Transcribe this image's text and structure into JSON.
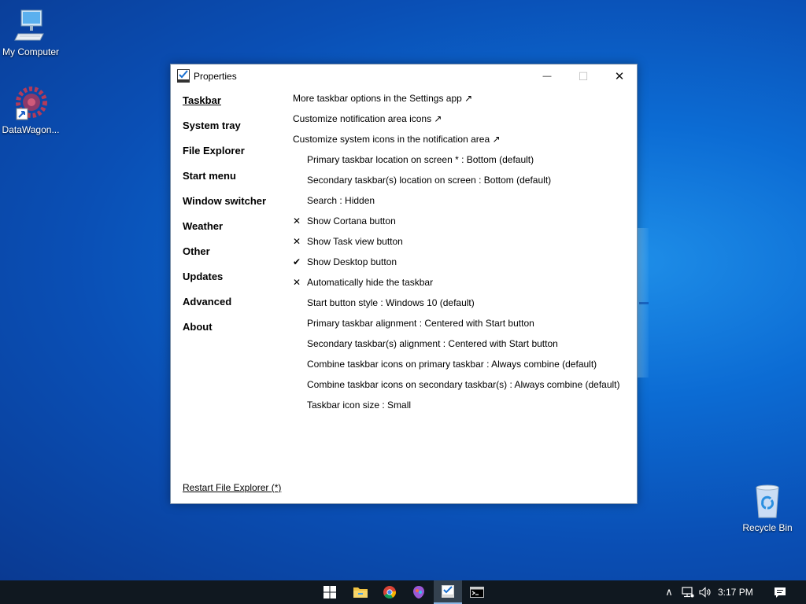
{
  "desktop": {
    "icons": [
      {
        "label": "My Computer"
      },
      {
        "label": "DataWagon..."
      },
      {
        "label": "Recycle Bin"
      }
    ]
  },
  "window": {
    "title": "Properties",
    "minimize_glyph": "—",
    "maximize_glyph": "☐",
    "close_glyph": "✕",
    "nav": [
      {
        "label": "Taskbar",
        "active": true
      },
      {
        "label": "System tray"
      },
      {
        "label": "File Explorer"
      },
      {
        "label": "Start menu"
      },
      {
        "label": "Window switcher"
      },
      {
        "label": "Weather"
      },
      {
        "label": "Other"
      },
      {
        "label": "Updates"
      },
      {
        "label": "Advanced"
      },
      {
        "label": "About"
      }
    ],
    "links": [
      {
        "label": "More taskbar options in the Settings app ↗"
      },
      {
        "label": "Customize notification area icons ↗"
      },
      {
        "label": "Customize system icons in the notification area ↗"
      }
    ],
    "settings": [
      {
        "mark": "",
        "label": "Primary taskbar location on screen * : Bottom (default)"
      },
      {
        "mark": "",
        "label": "Secondary taskbar(s) location on screen : Bottom (default)"
      },
      {
        "mark": "",
        "label": "Search : Hidden"
      },
      {
        "mark": "✕",
        "label": "Show Cortana button"
      },
      {
        "mark": "✕",
        "label": "Show Task view button"
      },
      {
        "mark": "✔",
        "label": "Show Desktop button"
      },
      {
        "mark": "✕",
        "label": "Automatically hide the taskbar"
      },
      {
        "mark": "",
        "label": "Start button style : Windows 10 (default)"
      },
      {
        "mark": "",
        "label": "Primary taskbar alignment : Centered with Start button"
      },
      {
        "mark": "",
        "label": "Secondary taskbar(s) alignment : Centered with Start button"
      },
      {
        "mark": "",
        "label": "Combine taskbar icons on primary taskbar : Always combine (default)"
      },
      {
        "mark": "",
        "label": "Combine taskbar icons on secondary taskbar(s) : Always combine (default)"
      },
      {
        "mark": "",
        "label": "Taskbar icon size : Small"
      }
    ],
    "restart_label": "Restart File Explorer (*)"
  },
  "taskbar": {
    "icons": [
      "start-icon",
      "file-explorer-icon",
      "chrome-icon",
      "paint-icon",
      "properties-app-icon",
      "command-prompt-icon"
    ],
    "active_icon": "properties-app-icon",
    "tray": {
      "chevron_glyph": "∧",
      "volume_glyph": "🔊",
      "clock": "3:17 PM"
    }
  },
  "colors": {
    "desktop_blue": "#0c6cd4",
    "taskbar": "#101820",
    "window_bg": "#ffffff",
    "accent": "#8ab6e4"
  }
}
